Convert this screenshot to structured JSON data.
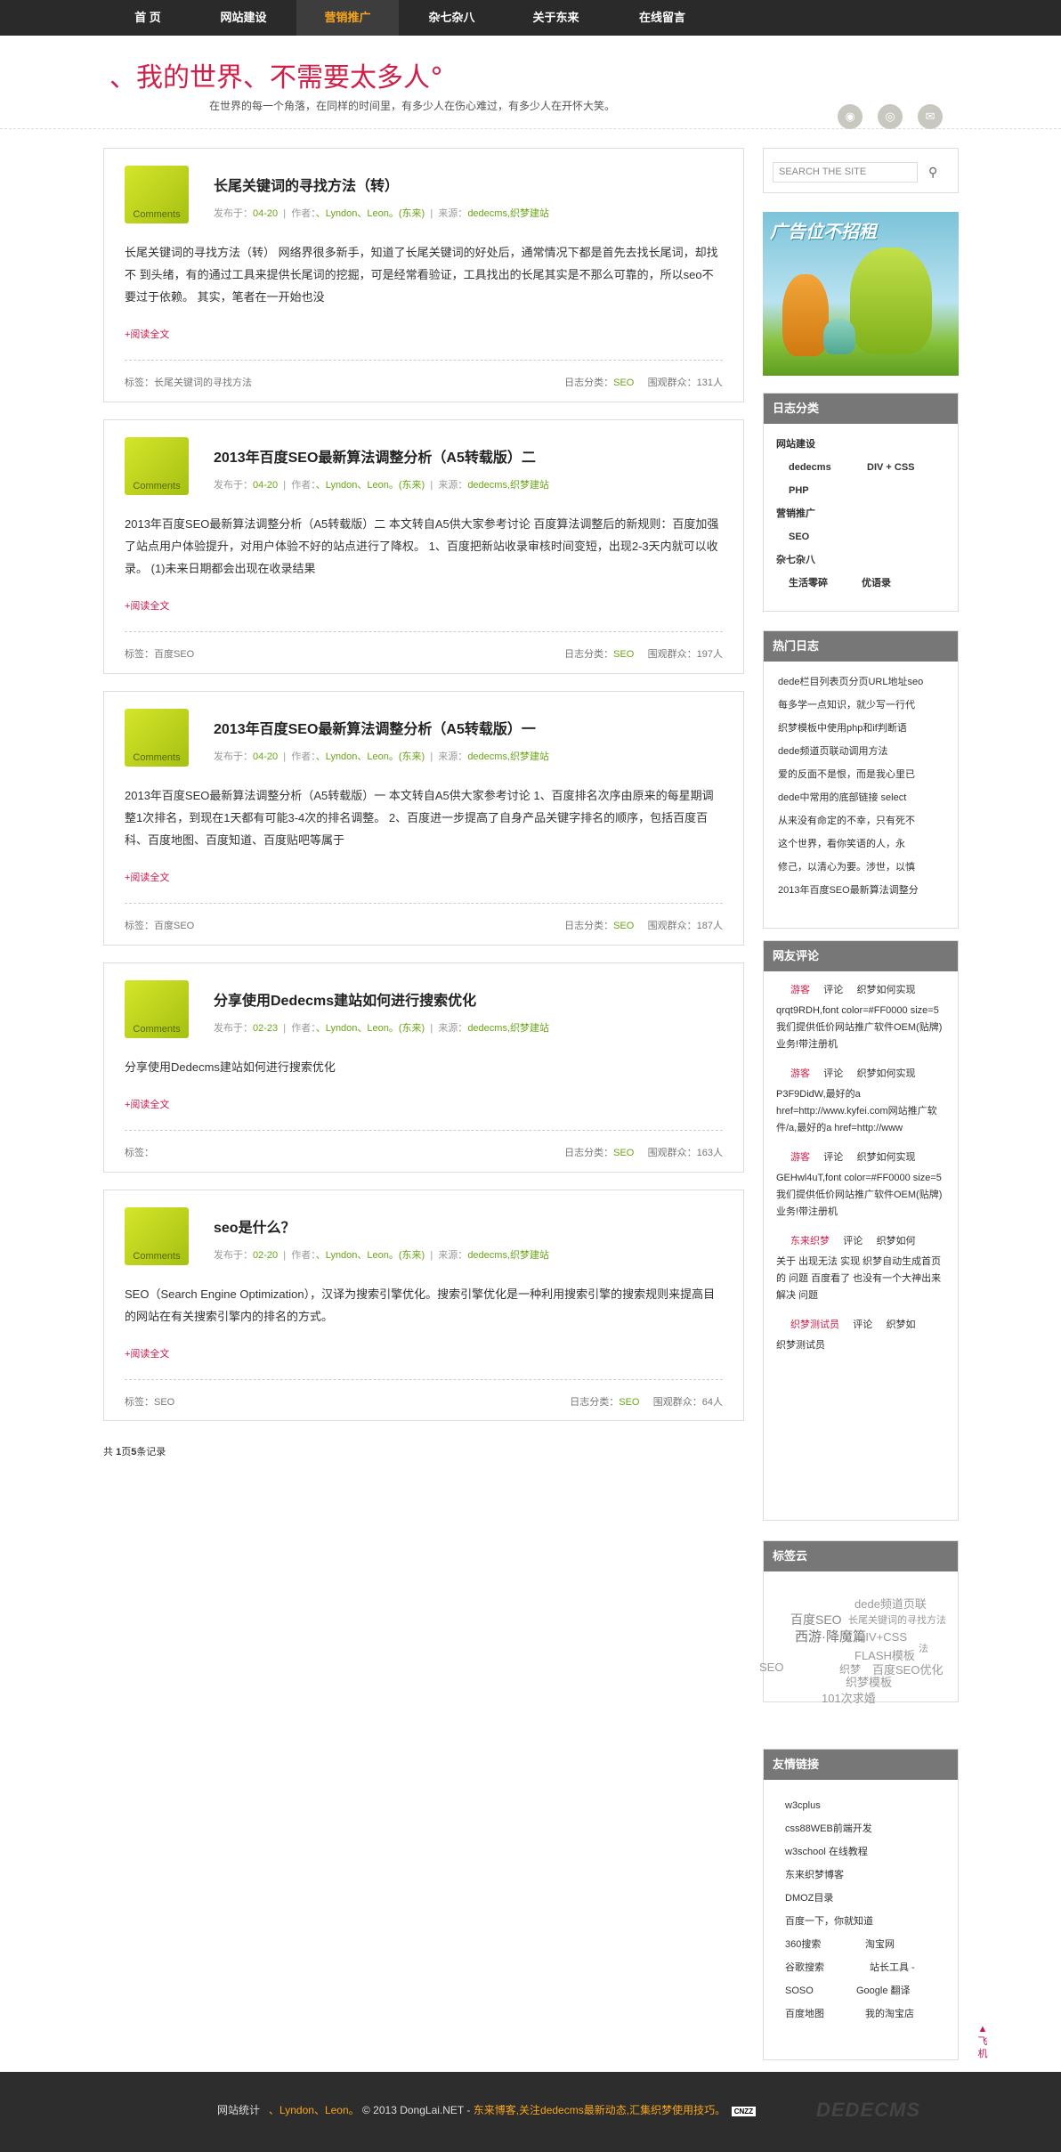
{
  "nav": [
    "首 页",
    "网站建设",
    "营销推广",
    "杂七杂八",
    "关于东来",
    "在线留言"
  ],
  "header": {
    "title": "、我的世界、不需要太多人°",
    "subtitle": "在世界的每一个角落，在同样的时间里，有多少人在伤心难过，有多少人在开怀大笑。"
  },
  "icons": {
    "rss": "rss-icon",
    "weibo": "weibo-icon",
    "mail": "mail-icon"
  },
  "posts": [
    {
      "title": "长尾关键词的寻找方法（转）",
      "date": "04-20",
      "author": "、Lyndon、Leon。(东来)",
      "source": "dedecms,织梦建站",
      "body": "长尾关键词的寻找方法（转） 网络界很多新手，知道了长尾关键词的好处后，通常情况下都是首先去找长尾词，却找不 到头绪，有的通过工具来提供长尾词的挖掘，可是经常看验证，工具找出的长尾其实是不那么可靠的，所以seo不要过于依赖。 其实，笔者在一开始也没",
      "tag": "长尾关键词的寻找方法",
      "cat": "SEO",
      "views": "131人"
    },
    {
      "title": "2013年百度SEO最新算法调整分析（A5转载版）二",
      "date": "04-20",
      "author": "、Lyndon、Leon。(东来)",
      "source": "dedecms,织梦建站",
      "body": "2013年百度SEO最新算法调整分析（A5转载版）二 本文转自A5供大家参考讨论 百度算法调整后的新规则：百度加强了站点用户体验提升，对用户体验不好的站点进行了降权。 1、百度把新站收录审核时间变短，出现2-3天内就可以收录。 (1)未来日期都会出现在收录结果",
      "tag": "百度SEO",
      "cat": "SEO",
      "views": "197人"
    },
    {
      "title": "2013年百度SEO最新算法调整分析（A5转载版）一",
      "date": "04-20",
      "author": "、Lyndon、Leon。(东来)",
      "source": "dedecms,织梦建站",
      "body": "2013年百度SEO最新算法调整分析（A5转载版）一 本文转自A5供大家参考讨论 1、百度排名次序由原来的每星期调整1次排名，到现在1天都有可能3-4次的排名调整。 2、百度进一步提高了自身产品关键字排名的顺序，包括百度百科、百度地图、百度知道、百度贴吧等属于",
      "tag": "百度SEO",
      "cat": "SEO",
      "views": "187人"
    },
    {
      "title": "分享使用Dedecms建站如何进行搜索优化",
      "date": "02-23",
      "author": "、Lyndon、Leon。(东来)",
      "source": "dedecms,织梦建站",
      "body": "分享使用Dedecms建站如何进行搜索优化",
      "tag": "",
      "cat": "SEO",
      "views": "163人"
    },
    {
      "title": "seo是什么？",
      "date": "02-20",
      "author": "、Lyndon、Leon。(东来)",
      "source": "dedecms,织梦建站",
      "body": "SEO（Search Engine Optimization），汉译为搜索引擎优化。搜索引擎优化是一种利用搜索引擎的搜索规则来提高目的网站在有关搜索引擎内的排名的方式。",
      "tag": "SEO",
      "cat": "SEO",
      "views": "64人"
    }
  ],
  "labels": {
    "posted": "发布于：",
    "author": "作者：",
    "source": "来源：",
    "comments": "Comments",
    "more": "+阅读全文",
    "tag": "标签：",
    "cat": "日志分类：",
    "views": "围观群众："
  },
  "pager": {
    "pre": "共 ",
    "pages": "1",
    "mid": "页",
    "records": "5",
    "post": "条记录"
  },
  "sidebar": {
    "search_placeholder": "SEARCH THE SITE",
    "ad_text": "广告位不招租",
    "cats_title": "日志分类",
    "cats": [
      {
        "name": "网站建设",
        "children": [
          "dedecms",
          "DIV + CSS",
          "PHP"
        ]
      },
      {
        "name": "营销推广",
        "children": [
          "SEO"
        ]
      },
      {
        "name": "杂七杂八",
        "children": [
          "生活零碎",
          "优语录"
        ]
      }
    ],
    "hot_title": "热门日志",
    "hot": [
      "dede栏目列表页分页URL地址seo",
      "每多学一点知识，就少写一行代",
      "织梦模板中使用php和if判断语",
      "dede频道页联动调用方法",
      "爱的反面不是恨，而是我心里已",
      "dede中常用的底部链接 select",
      "从来没有命定的不幸，只有死不",
      "这个世界，看你笑语的人，永",
      "修己，以清心为要。涉世，以慎",
      "2013年百度SEO最新算法调整分"
    ],
    "cmt_title": "网友评论",
    "comments": [
      {
        "who": "游客",
        "act": "评论",
        "target": "织梦如何实现",
        "text": "qrqt9RDH,font color=#FF0000 size=5我们提供低价网站推广软件OEM(贴牌)业务!带注册机"
      },
      {
        "who": "游客",
        "act": "评论",
        "target": "织梦如何实现",
        "text": "P3F9DidW,最好的a href=http://www.kyfei.com网站推广软件/a,最好的a href=http://www"
      },
      {
        "who": "游客",
        "act": "评论",
        "target": "织梦如何实现",
        "text": "GEHwl4uT,font color=#FF0000 size=5我们提供低价网站推广软件OEM(贴牌)业务!带注册机"
      },
      {
        "who": "东来织梦",
        "act": "评论",
        "target": "织梦如何",
        "text": "关于 出现无法 实现 织梦自动生成首页的 问题 百度看了 也没有一个大神出来 解决 问题"
      },
      {
        "who": "织梦测试员",
        "act": "评论",
        "target": "织梦如",
        "text": "织梦测试员"
      }
    ],
    "tags_title": "标签云",
    "tags": [
      "dede频道页联",
      "百度SEO",
      "长尾关键词的寻找方法",
      "西游·降魔篇",
      "DIV+CSS",
      "法",
      "FLASH模板",
      "SEO",
      "织梦",
      "百度SEO优化",
      "织梦模板",
      "101次求婚"
    ],
    "links_title": "友情链接",
    "links": [
      "w3cplus",
      "css88WEB前端开发",
      "w3school 在线教程",
      "东来织梦博客",
      "DMOZ目录",
      "百度一下，你就知道",
      "360搜索",
      "淘宝网",
      "谷歌搜索",
      "站长工具 -",
      "SOSO",
      "Google 翻译",
      "百度地图",
      "我的淘宝店"
    ]
  },
  "totop": "飞机",
  "footer": {
    "a": "网站统计",
    "b": "、Lyndon、Leon。",
    "c": "© 2013 DongLai.NET -",
    "d": "东来博客,关注dedecms最新动态,汇集织梦使用技巧。",
    "badge": "CNZZ",
    "logo": "DEDECMS"
  }
}
